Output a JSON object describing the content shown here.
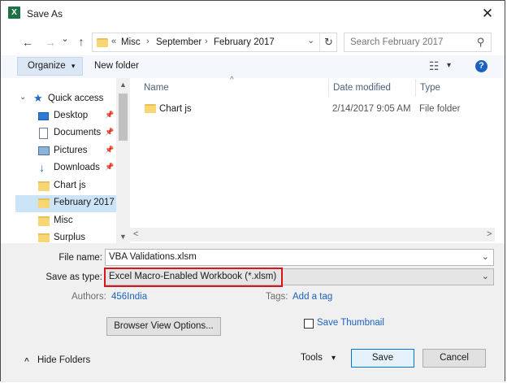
{
  "window": {
    "title": "Save As",
    "app_icon": "X",
    "close_glyph": "✕"
  },
  "nav": {
    "back_glyph": "←",
    "forward_glyph": "→",
    "recent_glyph": "⌄",
    "up_glyph": "↑",
    "breadcrumb_prefix": "«",
    "breadcrumbs": [
      "Misc",
      "September",
      "February 2017"
    ],
    "sep_glyph": "›",
    "dropdown_glyph": "⌄",
    "refresh_glyph": "↻",
    "search_placeholder": "Search February 2017",
    "search_glyph": "⚲"
  },
  "toolbar": {
    "organize_label": "Organize",
    "organize_glyph": "▾",
    "new_folder_label": "New folder",
    "view_glyph": "☷",
    "view_dropdown_glyph": "▾",
    "help_glyph": "?"
  },
  "sidebar": {
    "quick_access_label": "Quick access",
    "quick_access_glyph": "★",
    "expand_glyph": "⌄",
    "pin_glyph": "📌",
    "items": [
      {
        "label": "Desktop",
        "icon": "desktop-icon",
        "pinned": true
      },
      {
        "label": "Documents",
        "icon": "documents-icon",
        "pinned": true
      },
      {
        "label": "Pictures",
        "icon": "pictures-icon",
        "pinned": true
      },
      {
        "label": "Downloads",
        "icon": "downloads-icon",
        "pinned": true
      },
      {
        "label": "Chart js",
        "icon": "folder-icon",
        "pinned": false
      },
      {
        "label": "February 2017",
        "icon": "folder-icon",
        "pinned": false,
        "selected": true
      },
      {
        "label": "Misc",
        "icon": "folder-icon",
        "pinned": false
      },
      {
        "label": "Surplus",
        "icon": "folder-icon",
        "pinned": false
      }
    ]
  },
  "file_list": {
    "sort_glyph": "^",
    "columns": [
      "Name",
      "Date modified",
      "Type"
    ],
    "rows": [
      {
        "name": "Chart js",
        "date": "2/14/2017 9:05 AM",
        "type": "File folder"
      }
    ]
  },
  "scroll": {
    "up": "▲",
    "down": "▼",
    "left": "<",
    "right": ">"
  },
  "form": {
    "file_name_label": "File name:",
    "file_name_value": "VBA Validations.xlsm",
    "save_type_label": "Save as type:",
    "save_type_value": "Excel Macro-Enabled Workbook (*.xlsm)",
    "combo_glyph": "⌄",
    "authors_label": "Authors:",
    "authors_value": "456India",
    "tags_label": "Tags:",
    "tags_value": "Add a tag",
    "browser_view_label": "Browser View Options...",
    "save_thumbnail_label": "Save Thumbnail"
  },
  "footer": {
    "hide_folders_glyph": "^",
    "hide_folders_label": "Hide Folders",
    "tools_label": "Tools",
    "tools_glyph": "▾",
    "save_label": "Save",
    "cancel_label": "Cancel"
  },
  "colors": {
    "highlight_box": "#d9141a",
    "selected_item": "#cce4f7",
    "link": "#1b62bb"
  }
}
